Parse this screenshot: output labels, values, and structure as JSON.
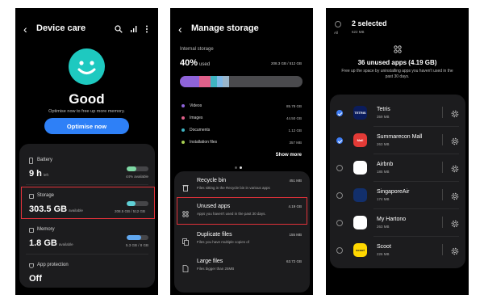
{
  "device_care": {
    "title": "Device care",
    "status": "Good",
    "subtitle": "Optimise now to free up more memory.",
    "optimise_button": "Optimise now",
    "battery": {
      "label": "Battery",
      "value": "9 h",
      "unit": "left",
      "right": "44% available",
      "fill": 0.44,
      "color": "#7ed8a4"
    },
    "storage": {
      "label": "Storage",
      "value": "303.5 GB",
      "unit": "available",
      "right": "208.5 GB / 512 GB",
      "fill": 0.41,
      "color": "#5fd0d6"
    },
    "memory": {
      "label": "Memory",
      "value": "1.8 GB",
      "unit": "available",
      "right": "5.3 GB / 8 GB",
      "fill": 0.66,
      "color": "#61a8f0"
    },
    "protection": {
      "label": "App protection",
      "value": "Off"
    }
  },
  "manage_storage": {
    "title": "Manage storage",
    "internal_label": "Internal storage",
    "percent": "40%",
    "percent_suffix": "used",
    "used_total": "208.3 GB / 512 GB",
    "bar_segments": [
      {
        "name": "Videos",
        "fraction": 0.16,
        "color": "#8e63d9"
      },
      {
        "name": "Images",
        "fraction": 0.09,
        "color": "#e0608a"
      },
      {
        "name": "Documents",
        "fraction": 0.05,
        "color": "#3fb4c2"
      },
      {
        "name": "Installation files",
        "fraction": 0.05,
        "color": "#7fb9e8"
      },
      {
        "name": "Other",
        "fraction": 0.05,
        "color": "#9ab7cc"
      }
    ],
    "legend": [
      {
        "label": "Videos",
        "value": "85.78 GB",
        "color": "#8e63d9"
      },
      {
        "label": "Images",
        "value": "44.50 GB",
        "color": "#e0608a"
      },
      {
        "label": "Documents",
        "value": "1.12 GB",
        "color": "#3fb4c2"
      },
      {
        "label": "Installation files",
        "value": "357 MB",
        "color": "#a9d152"
      }
    ],
    "show_more": "Show more",
    "rows": [
      {
        "title": "Recycle bin",
        "desc": "Files sitting in the Recycle bin in various apps",
        "value": "451 MB"
      },
      {
        "title": "Unused apps",
        "desc": "Apps you haven't used in the past 30 days.",
        "value": "4.19 GB"
      },
      {
        "title": "Duplicate files",
        "desc": "Files you have multiple copies of",
        "value": "155 MB"
      },
      {
        "title": "Large files",
        "desc": "Files bigger than 25MB",
        "value": "63.72 GB"
      }
    ]
  },
  "unused_apps": {
    "selected": "2 selected",
    "selected_size": "622 MB",
    "all_label": "All",
    "heading": "36 unused apps (4.19 GB)",
    "description": "Free up the space by uninstalling apps you haven't used in the past 30 days.",
    "apps": [
      {
        "name": "Tetris",
        "size": "359 MB",
        "checked": true,
        "icon_text": "TETRIS",
        "icon_color": "#0b1c5c"
      },
      {
        "name": "Summarecon Mall",
        "size": "263 MB",
        "checked": true,
        "icon_text": "Mall",
        "icon_color": "#e33a36"
      },
      {
        "name": "Airbnb",
        "size": "185 MB",
        "checked": false,
        "icon_text": "",
        "icon_color": "#ffffff"
      },
      {
        "name": "SingaporeAir",
        "size": "174 MB",
        "checked": false,
        "icon_text": "",
        "icon_color": "#122f6b"
      },
      {
        "name": "My Hartono",
        "size": "263 MB",
        "checked": false,
        "icon_text": "",
        "icon_color": "#ffffff"
      },
      {
        "name": "Scoot",
        "size": "226 MB",
        "checked": false,
        "icon_text": "scoot",
        "icon_color": "#ffd700"
      }
    ]
  }
}
